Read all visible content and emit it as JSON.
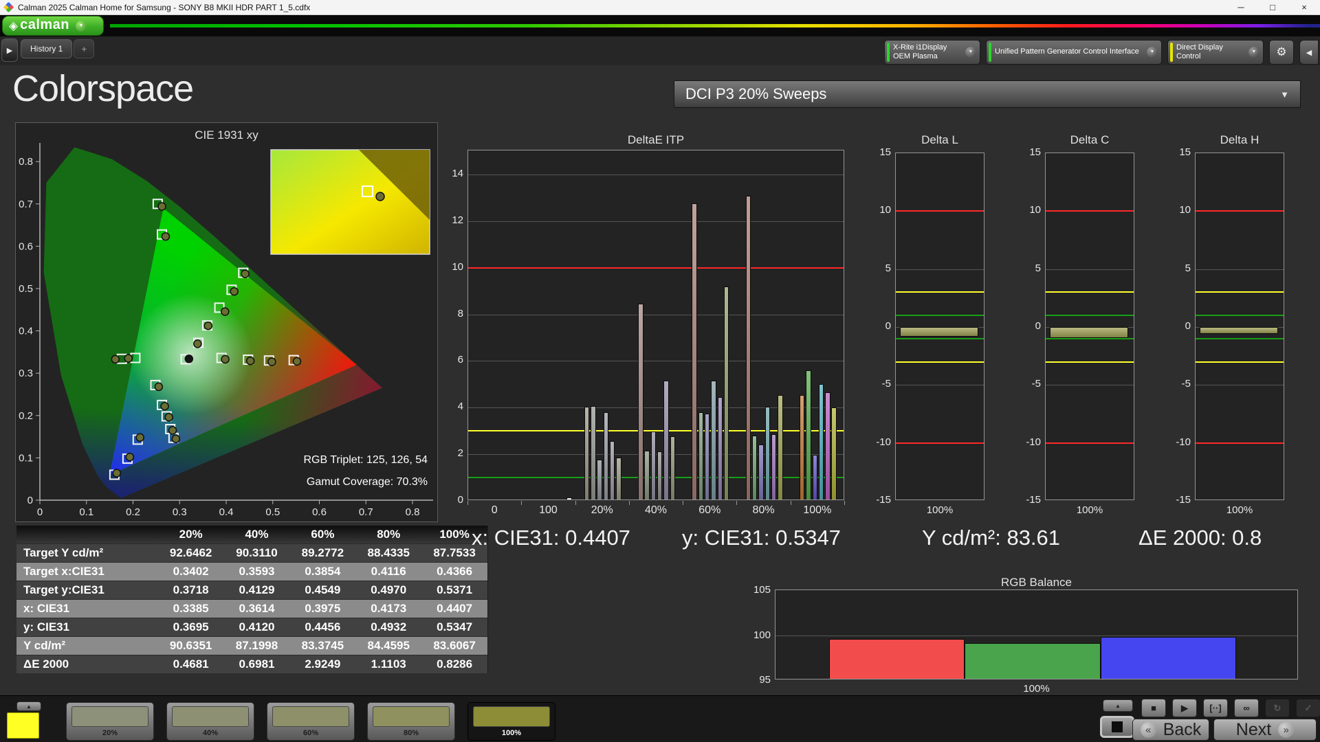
{
  "window": {
    "title": "Calman 2025 Calman Home for Samsung  - SONY B8 MKII HDR PART 1_5.cdfx",
    "controls": [
      {
        "name": "minimize",
        "glyph": "─"
      },
      {
        "name": "maximize",
        "glyph": "□"
      },
      {
        "name": "close",
        "glyph": "×"
      }
    ]
  },
  "logo_bar": {
    "brand": "calman",
    "diamond_glyph": "◈",
    "dropdown_glyph": "▼",
    "brand_green": "#3fae27"
  },
  "tab_bar": {
    "scroll_glyph": "▶",
    "tabs": [
      {
        "label": "History 1"
      }
    ],
    "add_label": "+"
  },
  "meter_bar": {
    "meters": [
      {
        "label": "X-Rite i1Display OEM Plasma",
        "status_color": "#2ed42e"
      },
      {
        "label": "Unified Pattern Generator Control Interface",
        "status_color": "#2ed42e"
      },
      {
        "label": "Direct Display Control",
        "status_color": "#e6e600"
      }
    ],
    "gear_glyph": "⚙",
    "collapse_glyph": "◀",
    "dropdown_glyph": "▼"
  },
  "main": {
    "page_title": "Colorspace",
    "preset": "DCI P3 20% Sweeps",
    "preset_arrow": "▼",
    "readouts": [
      "x: CIE31: 0.4407",
      "y: CIE31: 0.5347",
      "Y cd/m²: 83.61",
      "ΔE 2000: 0.8"
    ]
  },
  "chart_data": [
    {
      "id": "cie_1931_xy",
      "type": "scatter",
      "title": "CIE 1931 xy",
      "xlim": [
        0,
        0.84
      ],
      "ylim": [
        0,
        0.84
      ],
      "xticks": [
        "0",
        "0.1",
        "0.2",
        "0.3",
        "0.4",
        "0.5",
        "0.6",
        "0.7",
        "0.8"
      ],
      "yticks": [
        "0",
        "0.1",
        "0.2",
        "0.3",
        "0.4",
        "0.5",
        "0.6",
        "0.7",
        "0.8"
      ],
      "p3_primaries": {
        "r": [
          0.68,
          0.32
        ],
        "g": [
          0.265,
          0.69
        ],
        "b": [
          0.15,
          0.06
        ]
      },
      "white_index": 9,
      "series": [
        {
          "name": "target-squares",
          "points": [
            [
              0.3402,
              0.3718
            ],
            [
              0.3593,
              0.4129
            ],
            [
              0.3854,
              0.4549
            ],
            [
              0.4116,
              0.497
            ],
            [
              0.4366,
              0.5371
            ],
            [
              0.253,
              0.7
            ],
            [
              0.262,
              0.628
            ],
            [
              0.205,
              0.336
            ],
            [
              0.176,
              0.334
            ],
            [
              0.313,
              0.333
            ],
            [
              0.39,
              0.336
            ],
            [
              0.447,
              0.332
            ],
            [
              0.492,
              0.33
            ],
            [
              0.545,
              0.331
            ],
            [
              0.248,
              0.272
            ],
            [
              0.262,
              0.225
            ],
            [
              0.272,
              0.198
            ],
            [
              0.28,
              0.168
            ],
            [
              0.287,
              0.147
            ],
            [
              0.21,
              0.143
            ],
            [
              0.188,
              0.098
            ],
            [
              0.16,
              0.06
            ]
          ]
        },
        {
          "name": "measured-circles",
          "points": [
            [
              0.3385,
              0.3695
            ],
            [
              0.3614,
              0.412
            ],
            [
              0.3975,
              0.4456
            ],
            [
              0.4173,
              0.4932
            ],
            [
              0.4407,
              0.5347
            ],
            [
              0.262,
              0.694
            ],
            [
              0.27,
              0.623
            ],
            [
              0.19,
              0.335
            ],
            [
              0.162,
              0.333
            ],
            [
              0.32,
              0.334
            ],
            [
              0.398,
              0.333
            ],
            [
              0.452,
              0.329
            ],
            [
              0.498,
              0.327
            ],
            [
              0.552,
              0.328
            ],
            [
              0.255,
              0.268
            ],
            [
              0.268,
              0.222
            ],
            [
              0.277,
              0.196
            ],
            [
              0.285,
              0.165
            ],
            [
              0.292,
              0.145
            ],
            [
              0.215,
              0.148
            ],
            [
              0.193,
              0.102
            ],
            [
              0.165,
              0.064
            ]
          ]
        }
      ],
      "annotations": [
        "RGB Triplet: 125, 126, 54",
        "Gamut Coverage: 70.3%"
      ]
    },
    {
      "id": "deltae_itp",
      "type": "bar",
      "title": "DeltaE ITP",
      "ylim": [
        0,
        15.03
      ],
      "yticks": [
        0,
        2,
        4,
        6,
        8,
        10,
        12,
        14
      ],
      "gridlines": [
        2,
        4,
        6,
        8,
        10,
        12,
        14
      ],
      "ref_lines": [
        {
          "value": 10,
          "color": "#ff2828"
        },
        {
          "value": 3,
          "color": "#ffff2a"
        },
        {
          "value": 1,
          "color": "#16a016"
        }
      ],
      "groups": [
        {
          "category": "0",
          "bars": []
        },
        {
          "category": "100",
          "align": "right",
          "bars": [
            {
              "value": 0.15,
              "color": "#f2f2f2"
            }
          ]
        },
        {
          "category": "20%",
          "bars": [
            {
              "value": 4.05,
              "color": "#9d9588"
            },
            {
              "value": 4.08,
              "color": "#929690"
            },
            {
              "value": 1.78,
              "color": "#8e9298"
            },
            {
              "value": 3.8,
              "color": "#989ca4"
            },
            {
              "value": 2.57,
              "color": "#9b95a4"
            },
            {
              "value": 1.87,
              "color": "#989a84"
            }
          ]
        },
        {
          "category": "40%",
          "bars": [
            {
              "value": 8.45,
              "color": "#a08680"
            },
            {
              "value": 2.15,
              "color": "#8a9682"
            },
            {
              "value": 2.98,
              "color": "#8f8c9c"
            },
            {
              "value": 2.12,
              "color": "#909090"
            },
            {
              "value": 5.15,
              "color": "#948ba8"
            },
            {
              "value": 2.77,
              "color": "#92947a"
            }
          ]
        },
        {
          "category": "60%",
          "bars": [
            {
              "value": 12.75,
              "color": "#a57f76"
            },
            {
              "value": 3.8,
              "color": "#7f9e7f"
            },
            {
              "value": 3.74,
              "color": "#8584ad"
            },
            {
              "value": 5.16,
              "color": "#7f9ba5"
            },
            {
              "value": 4.45,
              "color": "#9383b2"
            },
            {
              "value": 9.2,
              "color": "#8f9e66"
            }
          ]
        },
        {
          "category": "80%",
          "bars": [
            {
              "value": 13.1,
              "color": "#aa7a6c"
            },
            {
              "value": 2.8,
              "color": "#6fa472"
            },
            {
              "value": 2.42,
              "color": "#7b79b8"
            },
            {
              "value": 4.05,
              "color": "#6fa4ad"
            },
            {
              "value": 2.87,
              "color": "#9d78bd"
            },
            {
              "value": 4.55,
              "color": "#9ea455"
            }
          ]
        },
        {
          "category": "100%",
          "bars": [
            {
              "value": 4.55,
              "color": "#c47a35"
            },
            {
              "value": 5.6,
              "color": "#55aa48"
            },
            {
              "value": 1.98,
              "color": "#6257c8"
            },
            {
              "value": 5.02,
              "color": "#4fb0bd"
            },
            {
              "value": 4.67,
              "color": "#b85fc0"
            },
            {
              "value": 4.0,
              "color": "#afb038"
            }
          ]
        }
      ]
    },
    {
      "id": "delta_l",
      "type": "bar",
      "title": "Delta L",
      "ylim": [
        -15,
        15
      ],
      "yticks": [
        15,
        10,
        5,
        0,
        -5,
        -10,
        -15
      ],
      "gridlines": [
        5,
        0,
        -5
      ],
      "ref_lines": [
        {
          "value": 10,
          "color": "#ff2828"
        },
        {
          "value": -10,
          "color": "#ff2828"
        },
        {
          "value": 3,
          "color": "#ffff2a"
        },
        {
          "value": -3,
          "color": "#ffff2a"
        },
        {
          "value": 1,
          "color": "#16a016"
        },
        {
          "value": -1,
          "color": "#16a016"
        }
      ],
      "categories": [
        "100%"
      ],
      "values": [
        -0.8
      ],
      "bar_color": "#a2a258"
    },
    {
      "id": "delta_c",
      "type": "bar",
      "title": "Delta C",
      "ylim": [
        -15,
        15
      ],
      "yticks": [
        15,
        10,
        5,
        0,
        -5,
        -10,
        -15
      ],
      "gridlines": [
        5,
        0,
        -5
      ],
      "ref_lines": [
        {
          "value": 10,
          "color": "#ff2828"
        },
        {
          "value": -10,
          "color": "#ff2828"
        },
        {
          "value": 3,
          "color": "#ffff2a"
        },
        {
          "value": -3,
          "color": "#ffff2a"
        },
        {
          "value": 1,
          "color": "#16a016"
        },
        {
          "value": -1,
          "color": "#16a016"
        }
      ],
      "categories": [
        "100%"
      ],
      "values": [
        -0.95
      ],
      "bar_color": "#a2a258"
    },
    {
      "id": "delta_h",
      "type": "bar",
      "title": "Delta H",
      "ylim": [
        -15,
        15
      ],
      "yticks": [
        15,
        10,
        5,
        0,
        -5,
        -10,
        -15
      ],
      "gridlines": [
        5,
        0,
        -5
      ],
      "ref_lines": [
        {
          "value": 10,
          "color": "#ff2828"
        },
        {
          "value": -10,
          "color": "#ff2828"
        },
        {
          "value": 3,
          "color": "#ffff2a"
        },
        {
          "value": -3,
          "color": "#ffff2a"
        },
        {
          "value": 1,
          "color": "#16a016"
        },
        {
          "value": -1,
          "color": "#16a016"
        }
      ],
      "categories": [
        "100%"
      ],
      "values": [
        -0.6
      ],
      "bar_color": "#a2a258"
    },
    {
      "id": "rgb_balance",
      "type": "bar",
      "title": "RGB Balance",
      "ylim": [
        95,
        105
      ],
      "yticks": [
        105,
        100,
        95
      ],
      "gridlines": [
        100
      ],
      "baseline": 95,
      "categories": [
        "100%"
      ],
      "series": [
        {
          "name": "red",
          "value": 99.6,
          "color": "#f24c4c"
        },
        {
          "name": "green",
          "value": 99.1,
          "color": "#4aa44c"
        },
        {
          "name": "blue",
          "value": 99.8,
          "color": "#4646f0"
        }
      ]
    },
    {
      "id": "measurement_table",
      "type": "table",
      "headers": [
        "",
        "20%",
        "40%",
        "60%",
        "80%",
        "100%"
      ],
      "rows": [
        {
          "label": "Target Y cd/m²",
          "values": [
            "92.6462",
            "90.3110",
            "89.2772",
            "88.4335",
            "87.7533"
          ]
        },
        {
          "label": "Target x:CIE31",
          "values": [
            "0.3402",
            "0.3593",
            "0.3854",
            "0.4116",
            "0.4366"
          ]
        },
        {
          "label": "Target y:CIE31",
          "values": [
            "0.3718",
            "0.4129",
            "0.4549",
            "0.4970",
            "0.5371"
          ]
        },
        {
          "label": "x: CIE31",
          "values": [
            "0.3385",
            "0.3614",
            "0.3975",
            "0.4173",
            "0.4407"
          ]
        },
        {
          "label": "y: CIE31",
          "values": [
            "0.3695",
            "0.4120",
            "0.4456",
            "0.4932",
            "0.5347"
          ]
        },
        {
          "label": "Y cd/m²",
          "values": [
            "90.6351",
            "87.1998",
            "83.3745",
            "84.4595",
            "83.6067"
          ]
        },
        {
          "label": "ΔE 2000",
          "values": [
            "0.4681",
            "0.6981",
            "2.9249",
            "1.1103",
            "0.8286"
          ]
        }
      ]
    }
  ],
  "bottom_bar": {
    "eject_glyph": "▲",
    "current_color": "#ffff24",
    "swatches": [
      {
        "label": "20%",
        "color": "#8d9179"
      },
      {
        "label": "40%",
        "color": "#8d9072"
      },
      {
        "label": "60%",
        "color": "#8e9069"
      },
      {
        "label": "80%",
        "color": "#8f915e"
      },
      {
        "label": "100%",
        "color": "#8c8d36",
        "selected": true
      }
    ],
    "stop_big_glyph": "■",
    "transport": [
      {
        "name": "stop-icon",
        "glyph": "■"
      },
      {
        "name": "play-icon",
        "glyph": "▶"
      },
      {
        "name": "pattern-window-icon",
        "glyph": "[··]"
      },
      {
        "name": "continuous-icon",
        "glyph": "∞"
      },
      {
        "name": "refresh-icon",
        "glyph": "↻",
        "dark": true
      },
      {
        "name": "accept-icon",
        "glyph": "✓",
        "dark": true
      }
    ],
    "back_glyph": "«",
    "back_label": "Back",
    "next_label": "Next",
    "next_glyph": "»"
  }
}
